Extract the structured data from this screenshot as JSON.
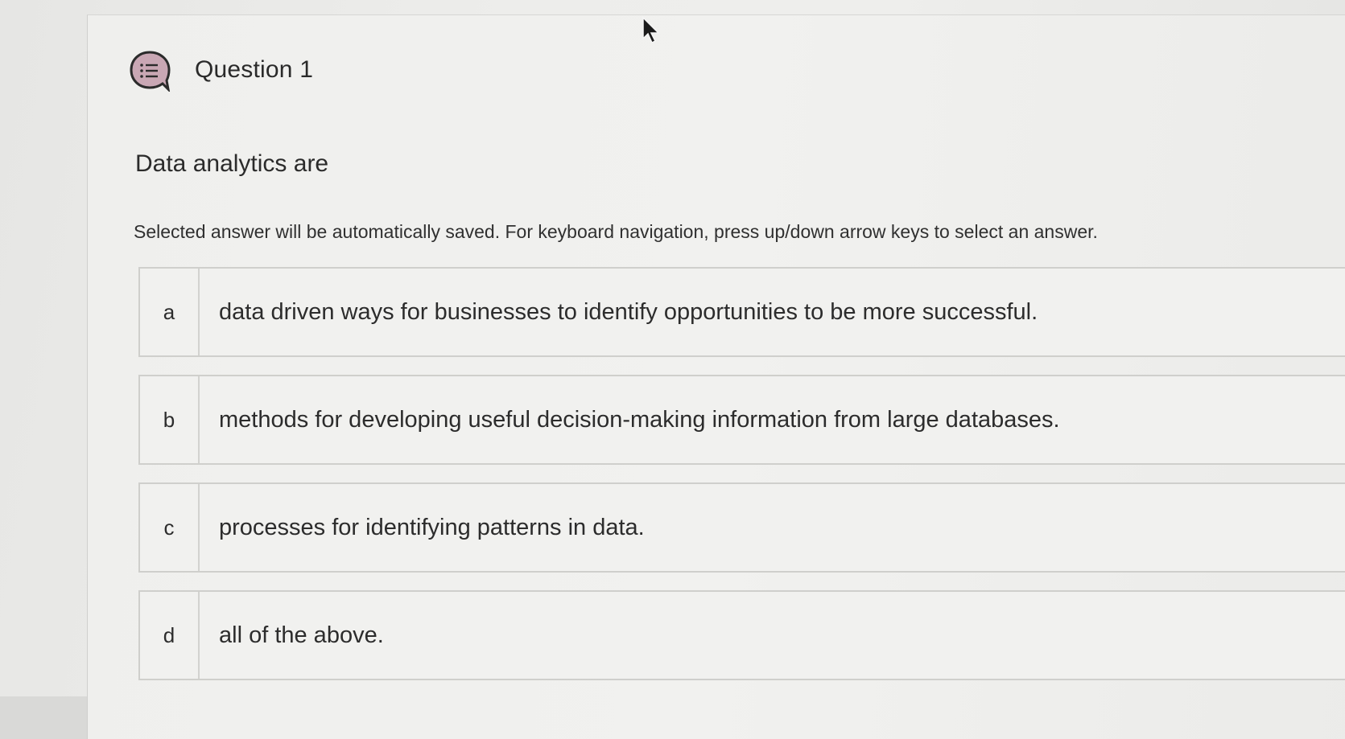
{
  "question": {
    "title": "Question 1",
    "prompt": "Data analytics are",
    "instructions": "Selected answer will be automatically saved. For keyboard navigation, press up/down arrow keys to select an answer.",
    "icon": "question-list-icon"
  },
  "options": [
    {
      "letter": "a",
      "text": "data driven ways for businesses to identify opportunities to be more successful."
    },
    {
      "letter": "b",
      "text": "methods for developing useful decision-making information from large databases."
    },
    {
      "letter": "c",
      "text": "processes for identifying patterns in data."
    },
    {
      "letter": "d",
      "text": "all of the above."
    }
  ],
  "colors": {
    "icon_fill": "#c9a7b4",
    "icon_stroke": "#2b2b2b",
    "border": "#cfcfcc"
  },
  "cursor": "mouse-pointer-icon"
}
